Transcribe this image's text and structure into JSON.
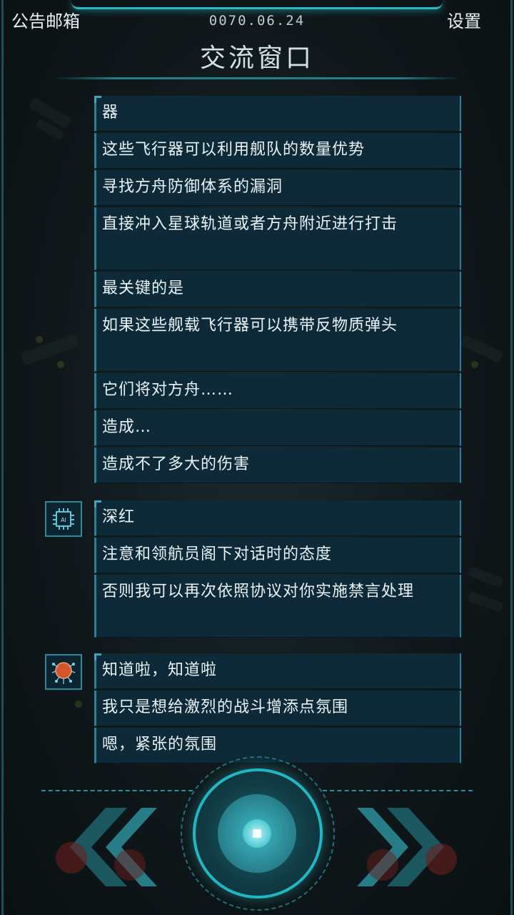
{
  "header": {
    "mailbox_label": "公告邮箱",
    "date": "0070.06.24",
    "settings_label": "设置",
    "title": "交流窗口"
  },
  "colors": {
    "accent": "#2bb7c4",
    "bubble_bg": "#0e2a38",
    "bubble_border": "#2c7f97"
  },
  "messages": [
    {
      "text": "器"
    },
    {
      "text": "这些飞行器可以利用舰队的数量优势"
    },
    {
      "text": "寻找方舟防御体系的漏洞"
    },
    {
      "text": "直接冲入星球轨道或者方舟附近进行打击"
    },
    {
      "text": "最关键的是"
    },
    {
      "text": "如果这些舰载飞行器可以携带反物质弹头"
    },
    {
      "text": "它们将对方舟……"
    },
    {
      "text": "造成…"
    },
    {
      "text": "造成不了多大的伤害"
    },
    {
      "text": "深红"
    },
    {
      "text": "注意和领航员阁下对话时的态度"
    },
    {
      "text": "否则我可以再次依照协议对你实施禁言处理"
    },
    {
      "text": "知道啦，知道啦"
    },
    {
      "text": "我只是想给激烈的战斗增添点氛围"
    },
    {
      "text": "嗯，紧张的氛围"
    }
  ],
  "avatars": [
    {
      "icon": "ai-chip-icon",
      "label": "AI"
    },
    {
      "icon": "brain-orb-icon"
    }
  ],
  "controls": {
    "prev": "double-chevron-left-icon",
    "center": "play-core-icon",
    "next": "double-chevron-right-icon"
  }
}
